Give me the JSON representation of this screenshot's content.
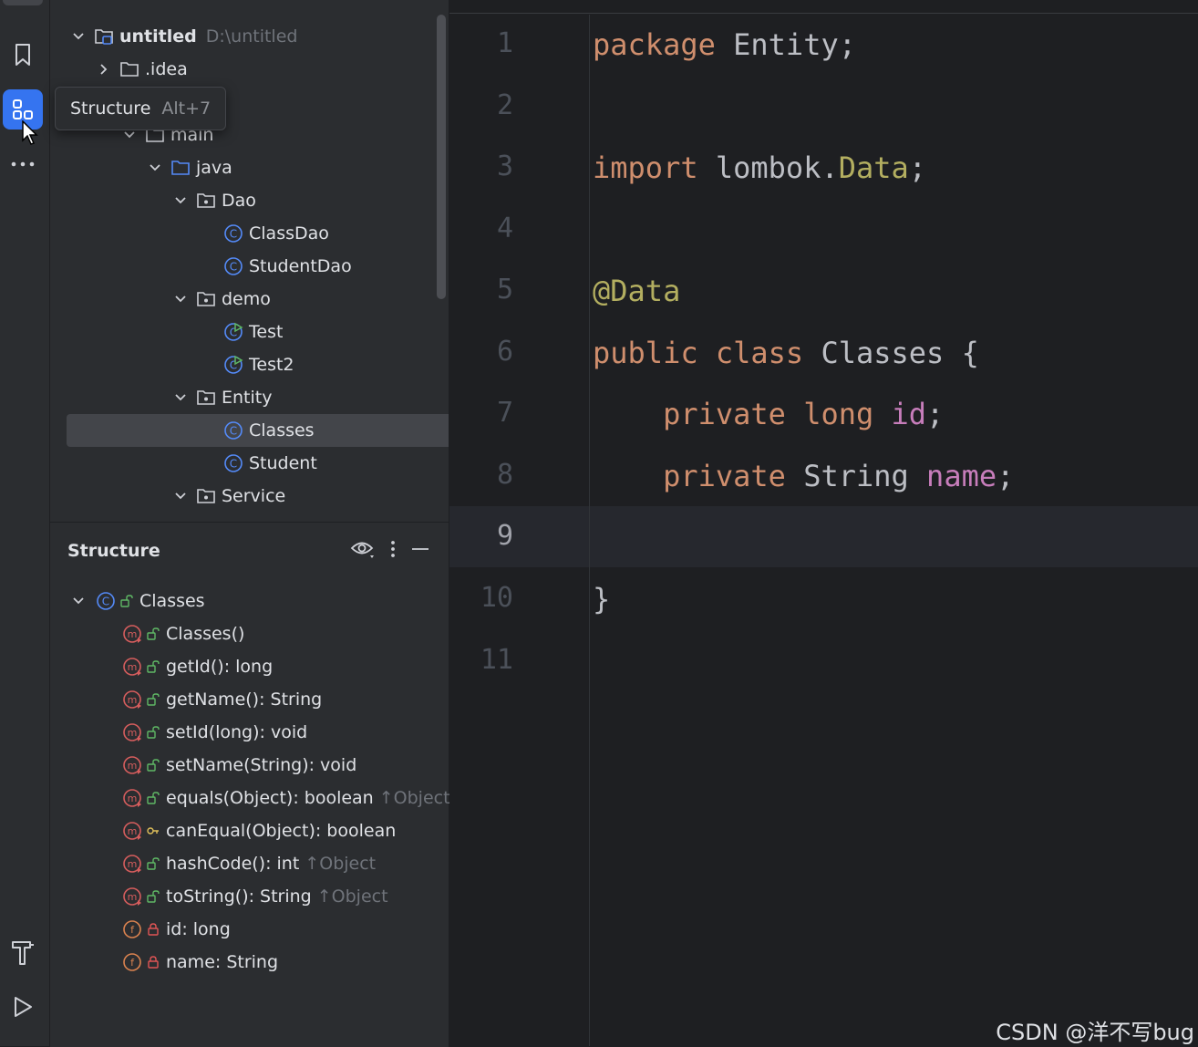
{
  "project_tree": {
    "root": {
      "name": "untitled",
      "path": "D:\\untitled"
    },
    "items": [
      {
        "label": ".idea",
        "type": "folder"
      },
      {
        "label": "main",
        "type": "folder"
      },
      {
        "label": "java",
        "type": "source-folder"
      },
      {
        "label": "Dao",
        "type": "package"
      },
      {
        "label": "ClassDao",
        "type": "class"
      },
      {
        "label": "StudentDao",
        "type": "class"
      },
      {
        "label": "demo",
        "type": "package"
      },
      {
        "label": "Test",
        "type": "runnable-class"
      },
      {
        "label": "Test2",
        "type": "runnable-class"
      },
      {
        "label": "Entity",
        "type": "package"
      },
      {
        "label": "Classes",
        "type": "class",
        "selected": true
      },
      {
        "label": "Student",
        "type": "class"
      },
      {
        "label": "Service",
        "type": "package"
      }
    ]
  },
  "tooltip": {
    "label": "Structure",
    "shortcut": "Alt+7"
  },
  "structure": {
    "title": "Structure",
    "root": "Classes",
    "members": [
      {
        "name": "Classes()",
        "kind": "method",
        "access": "public",
        "inherited": ""
      },
      {
        "name": "getId(): long",
        "kind": "method",
        "access": "public",
        "inherited": ""
      },
      {
        "name": "getName(): String",
        "kind": "method",
        "access": "public",
        "inherited": ""
      },
      {
        "name": "setId(long): void",
        "kind": "method",
        "access": "public",
        "inherited": ""
      },
      {
        "name": "setName(String): void",
        "kind": "method",
        "access": "public",
        "inherited": ""
      },
      {
        "name": "equals(Object): boolean",
        "kind": "method",
        "access": "public",
        "inherited": "↑Object"
      },
      {
        "name": "canEqual(Object): boolean",
        "kind": "method",
        "access": "protected",
        "inherited": ""
      },
      {
        "name": "hashCode(): int",
        "kind": "method",
        "access": "public",
        "inherited": "↑Object"
      },
      {
        "name": "toString(): String",
        "kind": "method",
        "access": "public",
        "inherited": "↑Object"
      },
      {
        "name": "id: long",
        "kind": "field",
        "access": "private",
        "inherited": ""
      },
      {
        "name": "name: String",
        "kind": "field",
        "access": "private",
        "inherited": ""
      }
    ]
  },
  "editor": {
    "current_line": 9,
    "line_numbers": [
      "1",
      "2",
      "3",
      "4",
      "5",
      "6",
      "7",
      "8",
      "9",
      "10",
      "11"
    ],
    "lines": {
      "l1": {
        "kw": "package",
        "rest": " Entity;"
      },
      "l3": {
        "kw": "import",
        "rest": " lombok.",
        "ann": "Data",
        "end": ";"
      },
      "l5": {
        "ann": "@Data"
      },
      "l6": {
        "kw": "public class",
        "rest": " Classes {"
      },
      "l7": {
        "indent": "    ",
        "kw": "private long",
        "sp": " ",
        "fld": "id",
        "end": ";"
      },
      "l8": {
        "indent": "    ",
        "kw": "private",
        "rest": " String ",
        "fld": "name",
        "end": ";"
      },
      "l10": {
        "rest": "}"
      }
    }
  },
  "watermark": "CSDN @洋不写bug",
  "colors": {
    "accent": "#3574f0",
    "keyword": "#cf8e6d",
    "annotation": "#b3ae60",
    "field": "#c77dbb",
    "method_icon": "#d65d5d",
    "field_icon": "#d9824f",
    "class_icon": "#548af7"
  }
}
